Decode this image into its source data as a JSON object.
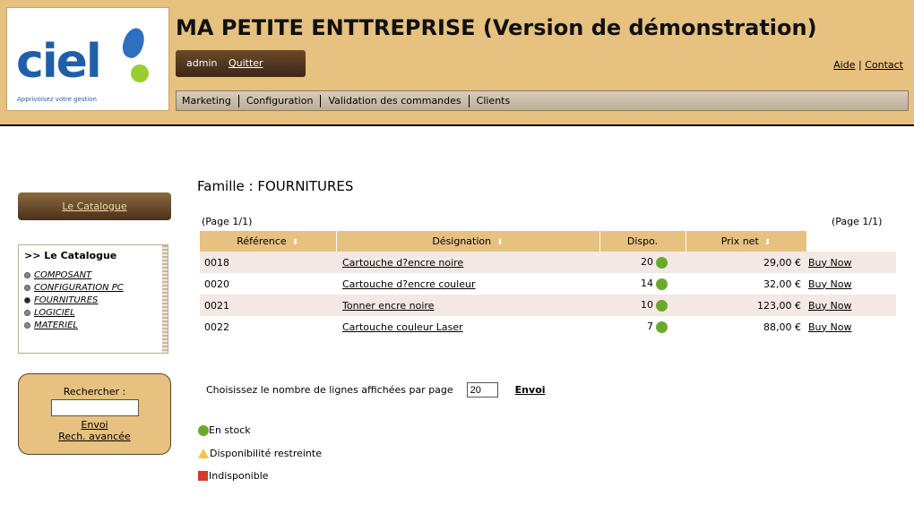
{
  "header": {
    "logo_text": "ciel",
    "logo_tagline": "Apprivoisez votre gestion",
    "title": "MA PETITE ENTTREPRISE (Version de démonstration)",
    "user": "admin",
    "logout_label": "Quitter",
    "help_label": "Aide",
    "links_sep": "|",
    "contact_label": "Contact"
  },
  "menu": {
    "items": [
      "Marketing",
      "Configuration",
      "Validation des commandes",
      "Clients"
    ]
  },
  "sidebar": {
    "catalogue_button": "Le Catalogue",
    "tree_title": ">> Le Catalogue",
    "tree_items": [
      "COMPOSANT",
      "CONFIGURATION PC",
      "FOURNITURES",
      "LOGICIEL",
      "MATERIEL"
    ],
    "active_item": "FOURNITURES",
    "search_label": "Rechercher :",
    "search_value": "",
    "search_submit": "Envoi",
    "search_advanced": "Rech. avancée"
  },
  "main": {
    "family_title": "Famille : FOURNITURES",
    "pager_left": "(Page 1/1)",
    "pager_right": "(Page 1/1)",
    "columns": [
      "Référence",
      "Désignation",
      "Dispo.",
      "Prix net"
    ],
    "sortable": [
      "Référence",
      "Désignation",
      "Prix net"
    ],
    "sort_icon": "sort-arrows-icon",
    "rows": [
      {
        "ref": "0018",
        "designation": "Cartouche d?encre noire",
        "dispo": "20",
        "prix": "29,00 €",
        "action": "Buy Now"
      },
      {
        "ref": "0020",
        "designation": "Cartouche d?encre couleur",
        "dispo": "14",
        "prix": "32,00 €",
        "action": "Buy Now"
      },
      {
        "ref": "0021",
        "designation": "Tonner encre noire",
        "dispo": "10",
        "prix": "123,00 €",
        "action": "Buy Now"
      },
      {
        "ref": "0022",
        "designation": "Cartouche couleur Laser",
        "dispo": "7",
        "prix": "88,00 €",
        "action": "Buy Now"
      }
    ],
    "rows_label": "Choisissez le nombre de lignes affichées par page",
    "rows_value": "20",
    "rows_submit": "Envoi"
  },
  "legend": {
    "in_stock": "En stock",
    "limited": "Disponibilité restreinte",
    "unavailable": "Indisponible"
  },
  "colors": {
    "header_bg": "#e6c17f",
    "stock_green": "#6aaa2a",
    "limited_yellow": "#f5c542",
    "unavailable_red": "#d63a2a",
    "row_alt": "#f4e8e4"
  }
}
